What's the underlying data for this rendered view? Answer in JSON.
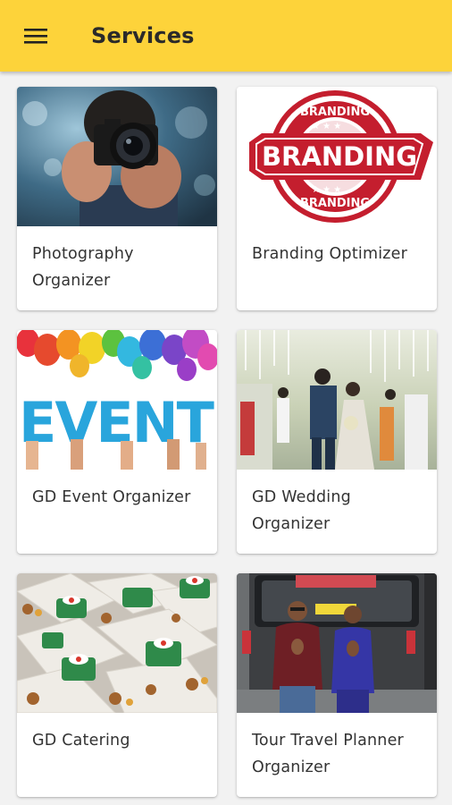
{
  "colors": {
    "appbar": "#FDD33A",
    "background": "#F2F2F2",
    "card": "#FFFFFF",
    "text": "#333333"
  },
  "appbar": {
    "menu_icon": "hamburger-menu-icon",
    "title": "Services"
  },
  "services": [
    {
      "label": "Photography Organizer",
      "image": "photographer-with-camera-image"
    },
    {
      "label": "Branding Optimizer",
      "image": "branding-stamp-image",
      "image_text": "BRANDING"
    },
    {
      "label": "GD Event Organizer",
      "image": "event-balloons-image",
      "image_text": "EVENT"
    },
    {
      "label": "GD Wedding Organizer",
      "image": "wedding-couple-image"
    },
    {
      "label": "GD Catering",
      "image": "catering-boxes-image"
    },
    {
      "label": "Tour Travel Planner Organizer",
      "image": "tour-guides-van-image"
    }
  ]
}
